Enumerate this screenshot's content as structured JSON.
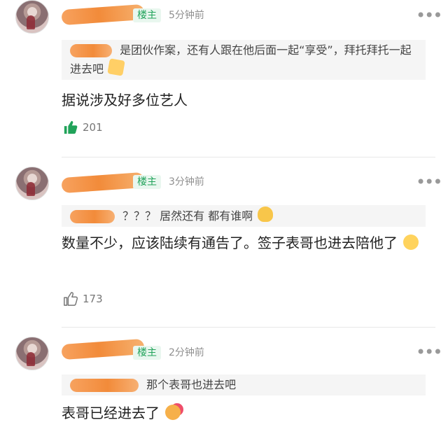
{
  "comments": [
    {
      "badge": "楼主",
      "time": "5分钟前",
      "quote_text": "是团伙作案，还有人跟在他后面一起“享受”，拜托拜托一起进去吧",
      "body": "据说涉及好多位艺人",
      "likes": "201",
      "liked": true,
      "emoji": "pray-icon"
    },
    {
      "badge": "楼主",
      "time": "3分钟前",
      "quote_text": "？？？ 居然还有 都有谁啊",
      "body": "数量不少，应该陆续有通告了。签子表哥也进去陪他了",
      "likes": "173",
      "liked": false,
      "emoji": "relieved-face-icon"
    },
    {
      "badge": "楼主",
      "time": "2分钟前",
      "quote_text": "那个表哥也进去吧",
      "body": "表哥已经进去了",
      "likes": "",
      "liked": false,
      "emoji": "smiling-hearts-face-icon"
    }
  ],
  "colors": {
    "accent_green": "#21a35a",
    "redaction_orange": "#f28b3a",
    "muted": "#8f8f8f"
  },
  "icons": {
    "more": "more-options-icon",
    "like_filled": "thumbs-up-filled-icon",
    "like_outline": "thumbs-up-outline-icon"
  }
}
